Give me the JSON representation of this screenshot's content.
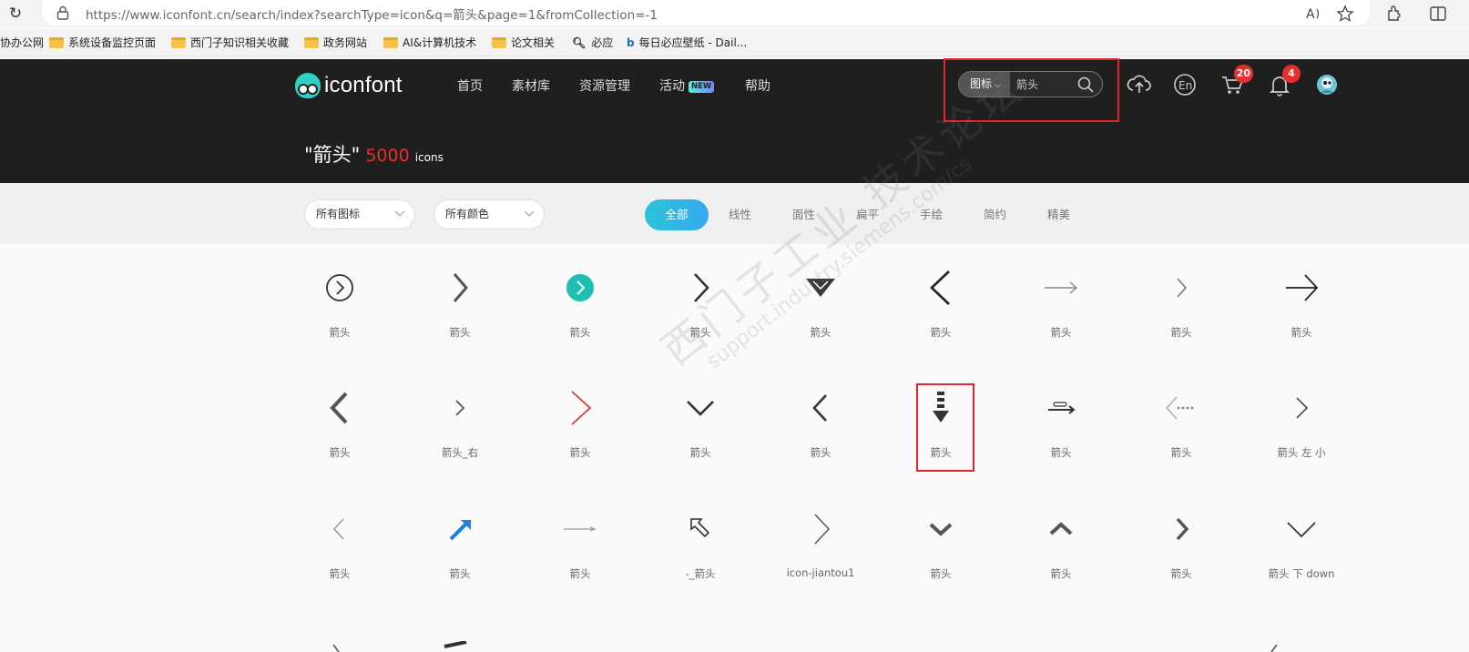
{
  "browser": {
    "url": "https://www.iconfont.cn/search/index?searchType=icon&q=箭头&page=1&fromCollection=-1",
    "bookmarks": [
      "协办公网",
      "系统设备监控页面",
      "西门子知识相关收藏",
      "政务网站",
      "AI&计算机技术",
      "论文相关",
      "必应",
      "每日必应壁纸 - Dail..."
    ]
  },
  "header": {
    "logo": "iconfont",
    "nav": [
      "首页",
      "素材库",
      "资源管理",
      "活动",
      "帮助"
    ],
    "new_badge": "NEW",
    "search": {
      "type_label": "图标",
      "value": "箭头"
    },
    "cart_count": "20",
    "notify_count": "4",
    "result": {
      "query": "\"箭头\"",
      "count": "5000",
      "unit": "icons"
    }
  },
  "filters": {
    "selects": [
      "所有图标",
      "所有颜色"
    ],
    "styles": [
      "全部",
      "线性",
      "面性",
      "扁平",
      "手绘",
      "简约",
      "精美"
    ]
  },
  "icons": {
    "rows": [
      [
        {
          "icon": "circle-chevron-right-icon",
          "label": "箭头"
        },
        {
          "icon": "chevron-right-bold-icon",
          "label": "箭头"
        },
        {
          "icon": "teal-circle-chevron-icon",
          "label": "箭头"
        },
        {
          "icon": "chevron-right-thin-icon",
          "label": "箭头"
        },
        {
          "icon": "triangle-down-icon",
          "label": "箭头"
        },
        {
          "icon": "chevron-left-large-icon",
          "label": "箭头"
        },
        {
          "icon": "arrow-right-line-icon",
          "label": "箭头"
        },
        {
          "icon": "chevron-right-light-icon",
          "label": "箭头"
        },
        {
          "icon": "arrow-right-long-icon",
          "label": "箭头"
        }
      ],
      [
        {
          "icon": "chevron-left-bold-icon",
          "label": "箭头"
        },
        {
          "icon": "chevron-right-small-icon",
          "label": "箭头_右"
        },
        {
          "icon": "chevron-right-red-icon",
          "label": "箭头"
        },
        {
          "icon": "chevron-down-icon",
          "label": "箭头"
        },
        {
          "icon": "chevron-left-icon",
          "label": "箭头"
        },
        {
          "icon": "dashed-arrow-down-icon",
          "label": "箭头"
        },
        {
          "icon": "arrow-right-bar-icon",
          "label": "箭头"
        },
        {
          "icon": "dotted-arrow-left-icon",
          "label": "箭头"
        },
        {
          "icon": "chevron-right-grey-icon",
          "label": "箭头 左 小"
        }
      ],
      [
        {
          "icon": "chevron-left-thin-icon",
          "label": "箭头"
        },
        {
          "icon": "arrow-up-right-blue-icon",
          "label": "箭头"
        },
        {
          "icon": "arrow-right-grey-line-icon",
          "label": "箭头"
        },
        {
          "icon": "arrow-up-left-outline-icon",
          "label": "-_箭头"
        },
        {
          "icon": "chevron-right-outline-icon",
          "label": "icon-jiantou1"
        },
        {
          "icon": "chevron-down-bold-icon",
          "label": "箭头"
        },
        {
          "icon": "chevron-up-bold-icon",
          "label": "箭头"
        },
        {
          "icon": "chevron-right-dark-icon",
          "label": "箭头"
        },
        {
          "icon": "chevron-down-thin-icon",
          "label": "箭头 下 down"
        }
      ]
    ]
  },
  "watermark": {
    "cn": "西门子工业 技术论坛",
    "en": "support.industry.siemens.com/cs"
  },
  "colors": {
    "accent": "#2bc4d8",
    "count_red": "#e62e2e",
    "header_bg": "#1f1f1f",
    "highlight": "#e0262b",
    "teal_icon": "#1fc0b3",
    "blue_icon": "#1a7fe0"
  }
}
